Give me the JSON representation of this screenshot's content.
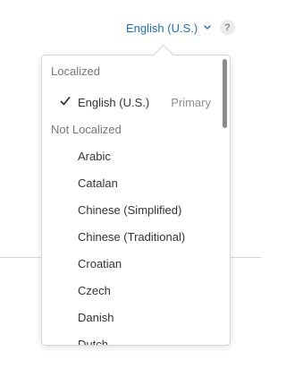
{
  "header": {
    "language_selected": "English (U.S.)",
    "help_label": "?"
  },
  "popover": {
    "localized_header": "Localized",
    "localized_items": [
      {
        "label": "English (U.S.)",
        "badge": "Primary",
        "checked": true
      }
    ],
    "not_localized_header": "Not Localized",
    "not_localized_items": [
      "Arabic",
      "Catalan",
      "Chinese (Simplified)",
      "Chinese (Traditional)",
      "Croatian",
      "Czech",
      "Danish",
      "Dutch"
    ]
  },
  "colors": {
    "accent": "#1a6fc2",
    "text": "#333333",
    "muted": "#777777"
  }
}
